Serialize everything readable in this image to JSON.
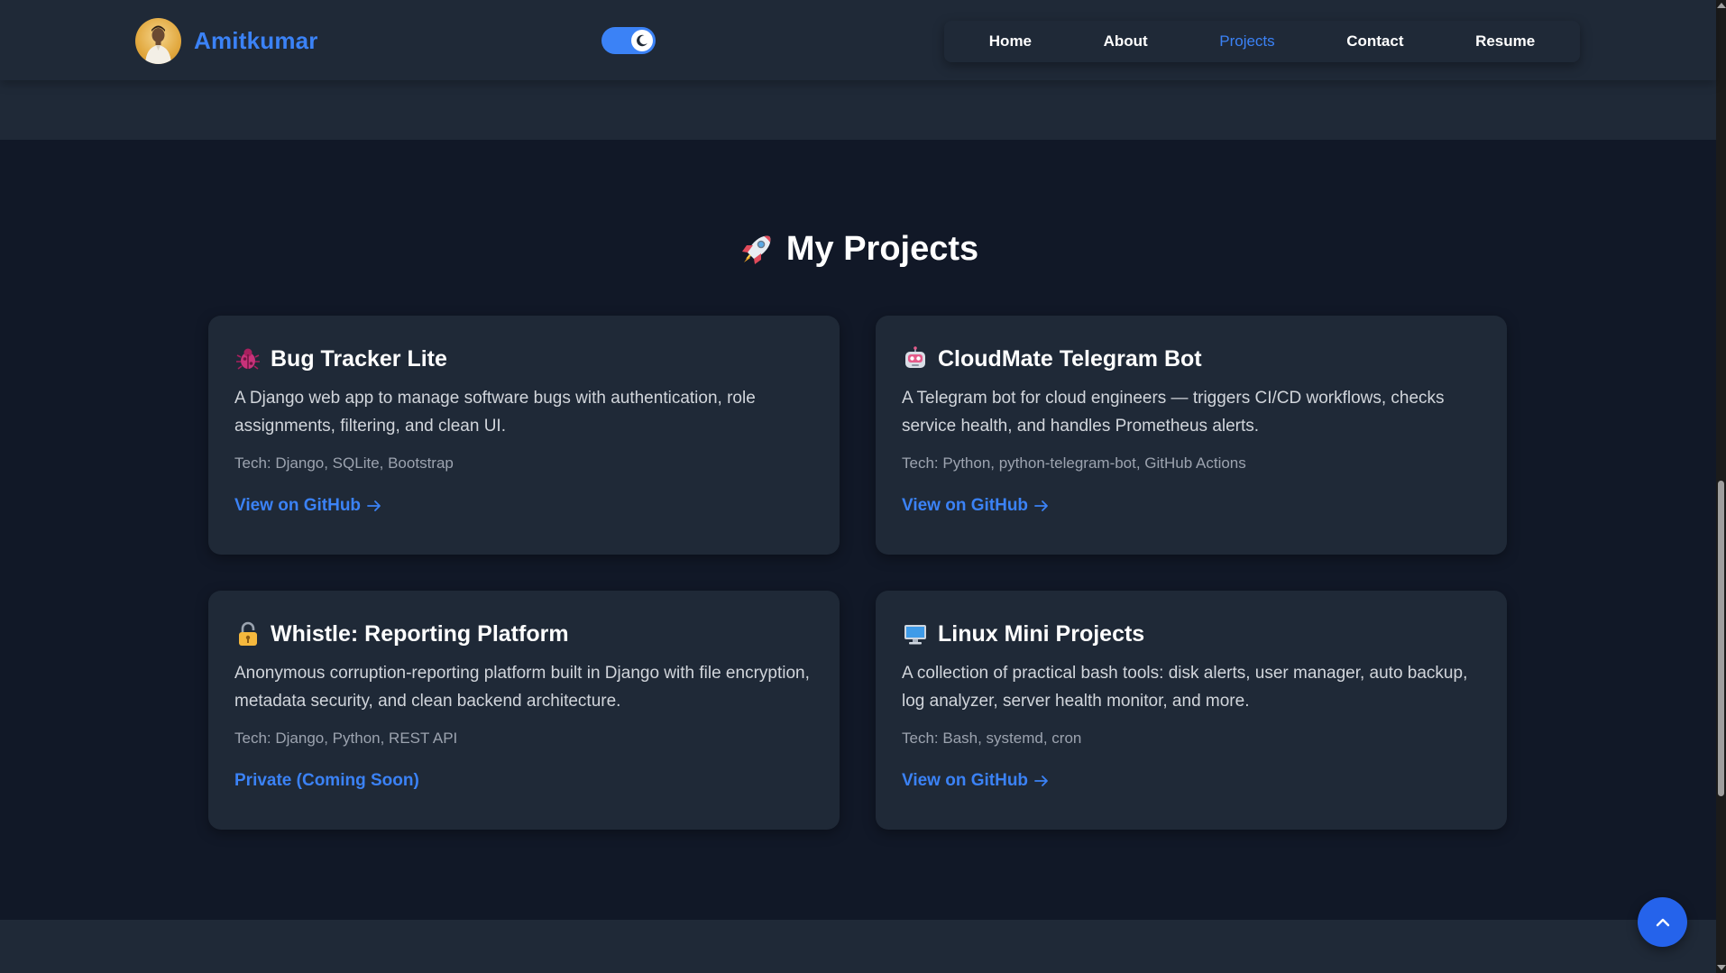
{
  "header": {
    "brand_name": "Amitkumar",
    "theme_toggle": {
      "state": "dark",
      "icon": "moon-icon"
    },
    "nav": [
      {
        "label": "Home",
        "active": false
      },
      {
        "label": "About",
        "active": false
      },
      {
        "label": "Projects",
        "active": true
      },
      {
        "label": "Contact",
        "active": false
      },
      {
        "label": "Resume",
        "active": false
      }
    ]
  },
  "projects": {
    "title_icon": "rocket-icon",
    "title": "My Projects",
    "cards": [
      {
        "icon": "bug-icon",
        "title": "Bug Tracker Lite",
        "description": "A Django web app to manage software bugs with authentication, role assignments, filtering, and clean UI.",
        "tech": "Tech: Django, SQLite, Bootstrap",
        "link_label": "View on GitHub",
        "link_icon": "arrow-right-icon"
      },
      {
        "icon": "robot-icon",
        "title": "CloudMate Telegram Bot",
        "description": "A Telegram bot for cloud engineers — triggers CI/CD workflows, checks service health, and handles Prometheus alerts.",
        "tech": "Tech: Python, python-telegram-bot, GitHub Actions",
        "link_label": "View on GitHub",
        "link_icon": "arrow-right-icon"
      },
      {
        "icon": "lock-icon",
        "title": "Whistle: Reporting Platform",
        "description": "Anonymous corruption-reporting platform built in Django with file encryption, metadata security, and clean backend architecture.",
        "tech": "Tech: Django, Python, REST API",
        "link_label": "Private (Coming Soon)",
        "link_icon": ""
      },
      {
        "icon": "computer-icon",
        "title": "Linux Mini Projects",
        "description": "A collection of practical bash tools: disk alerts, user manager, auto backup, log analyzer, server health monitor, and more.",
        "tech": "Tech: Bash, systemd, cron",
        "link_label": "View on GitHub",
        "link_icon": "arrow-right-icon"
      }
    ]
  },
  "back_to_top": {
    "icon": "chevron-up-icon"
  },
  "colors": {
    "accent": "#3b82f6",
    "page_bg": "#111827",
    "card_bg": "#1f2937"
  }
}
